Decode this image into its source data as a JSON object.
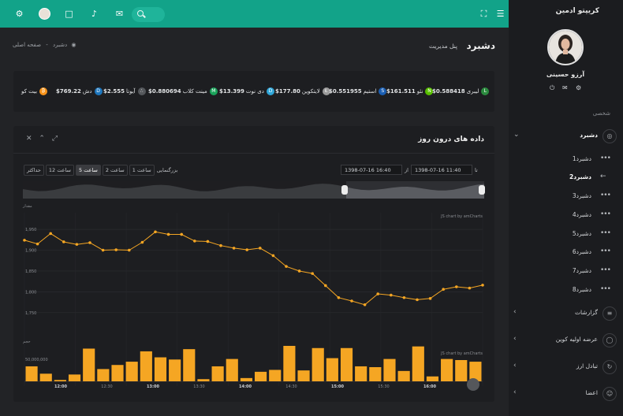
{
  "topbar": {
    "icons": [
      "gear-icon",
      "user-avatar",
      "chat-icon",
      "bell-icon",
      "mail-icon",
      "search-icon"
    ]
  },
  "sidebar": {
    "brand": "کریپتو ادمین",
    "user_name": "آرزو حسینی",
    "section_label": "شخصی",
    "dashboard_label": "دشبرد",
    "sub_items": [
      "دشبرد1",
      "دشبرد2",
      "دشبرد3",
      "دشبرد4",
      "دشبرد5",
      "دشبرد6",
      "دشبرد7",
      "دشبرد8"
    ],
    "active_sub": "دشبرد2",
    "menu": [
      {
        "label": "گزارشات",
        "icon": "chart-icon"
      },
      {
        "label": "عرضه اولیه کوین",
        "icon": "coin-icon"
      },
      {
        "label": "تبادل ارز",
        "icon": "exchange-icon"
      },
      {
        "label": "اعضا",
        "icon": "user-icon"
      }
    ]
  },
  "header": {
    "title": "دشبرد",
    "subtitle": "پنل مدیریت",
    "breadcrumb_home": "صفحه اصلی",
    "breadcrumb_sep": "-",
    "breadcrumb_current": "دشبرد"
  },
  "ticker": [
    {
      "name": "بیت کو",
      "value": "",
      "color": "#f7931a"
    },
    {
      "name": "دش",
      "value": "$769.22",
      "color": "#1c75bc"
    },
    {
      "name": "آیوتا",
      "value": "$2.555",
      "color": "#9fa3a8"
    },
    {
      "name": "مینت کلاب",
      "value": "$0.880694",
      "color": "#1aa35a"
    },
    {
      "name": "دی نوت",
      "value": "$13.399",
      "color": "#2fa6d8"
    },
    {
      "name": "لایتکوین",
      "value": "$177.80",
      "color": "#9a9a9a"
    },
    {
      "name": "استیم",
      "value": "$0.551955",
      "color": "#1a5fb4"
    },
    {
      "name": "نئو",
      "value": "$161.511",
      "color": "#58bf00"
    },
    {
      "name": "لیبری",
      "value": "$0.588418",
      "color": "#2b8a3e"
    }
  ],
  "card": {
    "title": "داده های درون روز",
    "zoom_label": "بزرگنمایی",
    "zoom_buttons": [
      "1 ساعت",
      "2 ساعت",
      "5 ساعت",
      "12 ساعت",
      "حداکثر"
    ],
    "zoom_active": "5 ساعت",
    "from_label": "از",
    "to_label": "تا",
    "from_value": "1398-07-16 11:40",
    "to_value": "1398-07-16 16:40",
    "credit": "JS chart by amCharts"
  },
  "chart_data": {
    "type": "line",
    "title": "",
    "ylabel": "مقدار",
    "ylabel2": "حجم",
    "ylim": [
      1725,
      1990
    ],
    "y_ticks": [
      1750,
      1800,
      1850,
      1900,
      1950
    ],
    "x_ticks": [
      "12:00",
      "12:30",
      "13:00",
      "13:30",
      "14:00",
      "14:30",
      "15:00",
      "15:30",
      "16:00"
    ],
    "series": [
      {
        "values": [
          1924,
          1915,
          1940,
          1920,
          1914,
          1918,
          1900,
          1901,
          1900,
          1919,
          1944,
          1938,
          1938,
          1922,
          1921,
          1911,
          1905,
          1901,
          1905,
          1887,
          1861,
          1850,
          1844,
          1815,
          1786,
          1778,
          1769,
          1795,
          1792,
          1786,
          1781,
          1784,
          1806,
          1812,
          1809,
          1816
        ]
      }
    ],
    "volume_ticks": [
      "50,000,000"
    ],
    "volume": [
      55,
      28,
      5,
      25,
      120,
      45,
      60,
      72,
      110,
      88,
      80,
      118,
      8,
      55,
      82,
      12,
      35,
      42,
      130,
      40,
      122,
      85,
      122,
      55,
      52,
      82,
      38,
      128,
      18,
      82,
      78,
      72
    ]
  }
}
